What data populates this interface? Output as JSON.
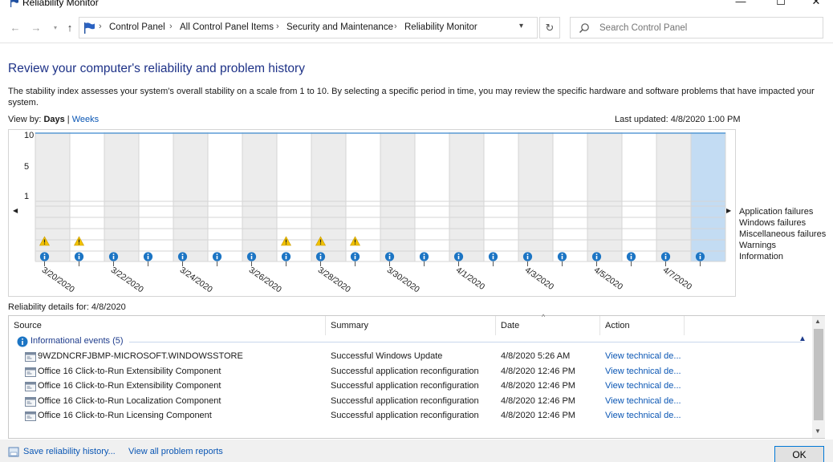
{
  "window": {
    "title": "Reliability Monitor"
  },
  "address": {
    "crumbs": [
      "Control Panel",
      "All Control Panel Items",
      "Security and Maintenance",
      "Reliability Monitor"
    ],
    "search_placeholder": "Search Control Panel"
  },
  "page": {
    "heading": "Review your computer's reliability and problem history",
    "description": "The stability index assesses your system's overall stability on a scale from 1 to 10. By selecting a specific period in time, you may review the specific hardware and software problems that have impacted your system.",
    "view_by_label": "View by:",
    "view_days": "Days",
    "view_sep": "|",
    "view_weeks": "Weeks",
    "last_updated": "Last updated: 4/8/2020 1:00 PM"
  },
  "chart": {
    "y_ticks": [
      "10",
      "5",
      "1"
    ],
    "date_labels": [
      "3/20/2020",
      "3/22/2020",
      "3/24/2020",
      "3/26/2020",
      "3/28/2020",
      "3/30/2020",
      "4/1/2020",
      "4/3/2020",
      "4/5/2020",
      "4/7/2020"
    ],
    "row_labels": [
      "Application failures",
      "Windows failures",
      "Miscellaneous failures",
      "Warnings",
      "Information"
    ],
    "day_count": 20,
    "selected_day_index": 19,
    "warning_day_indexes": [
      0,
      1,
      7,
      8,
      9
    ],
    "info_day_indexes": [
      0,
      1,
      2,
      3,
      4,
      5,
      6,
      7,
      8,
      9,
      10,
      11,
      12,
      13,
      14,
      15,
      16,
      17,
      18,
      19
    ],
    "colors": {
      "selected": "#c3dcf3",
      "shaded": "#ececec",
      "grid": "#d5d5d5",
      "line": "#5b9bd5",
      "info": "#1c75c4",
      "warning": "#f2c200"
    }
  },
  "details": {
    "title": "Reliability details for: 4/8/2020",
    "columns": [
      "Source",
      "Summary",
      "Date",
      "Action"
    ],
    "group_label": "Informational events (5)",
    "rows": [
      {
        "source": "9WZDNCRFJBMP-MICROSOFT.WINDOWSSTORE",
        "summary": "Successful Windows Update",
        "date": "4/8/2020 5:26 AM",
        "action": "View technical de..."
      },
      {
        "source": "Office 16 Click-to-Run Extensibility Component",
        "summary": "Successful application reconfiguration",
        "date": "4/8/2020 12:46 PM",
        "action": "View technical de..."
      },
      {
        "source": "Office 16 Click-to-Run Extensibility Component",
        "summary": "Successful application reconfiguration",
        "date": "4/8/2020 12:46 PM",
        "action": "View technical de..."
      },
      {
        "source": "Office 16 Click-to-Run Localization Component",
        "summary": "Successful application reconfiguration",
        "date": "4/8/2020 12:46 PM",
        "action": "View technical de..."
      },
      {
        "source": "Office 16 Click-to-Run Licensing Component",
        "summary": "Successful application reconfiguration",
        "date": "4/8/2020 12:46 PM",
        "action": "View technical de..."
      }
    ]
  },
  "footer": {
    "save_history": "Save reliability history...",
    "view_reports": "View all problem reports",
    "ok": "OK"
  }
}
